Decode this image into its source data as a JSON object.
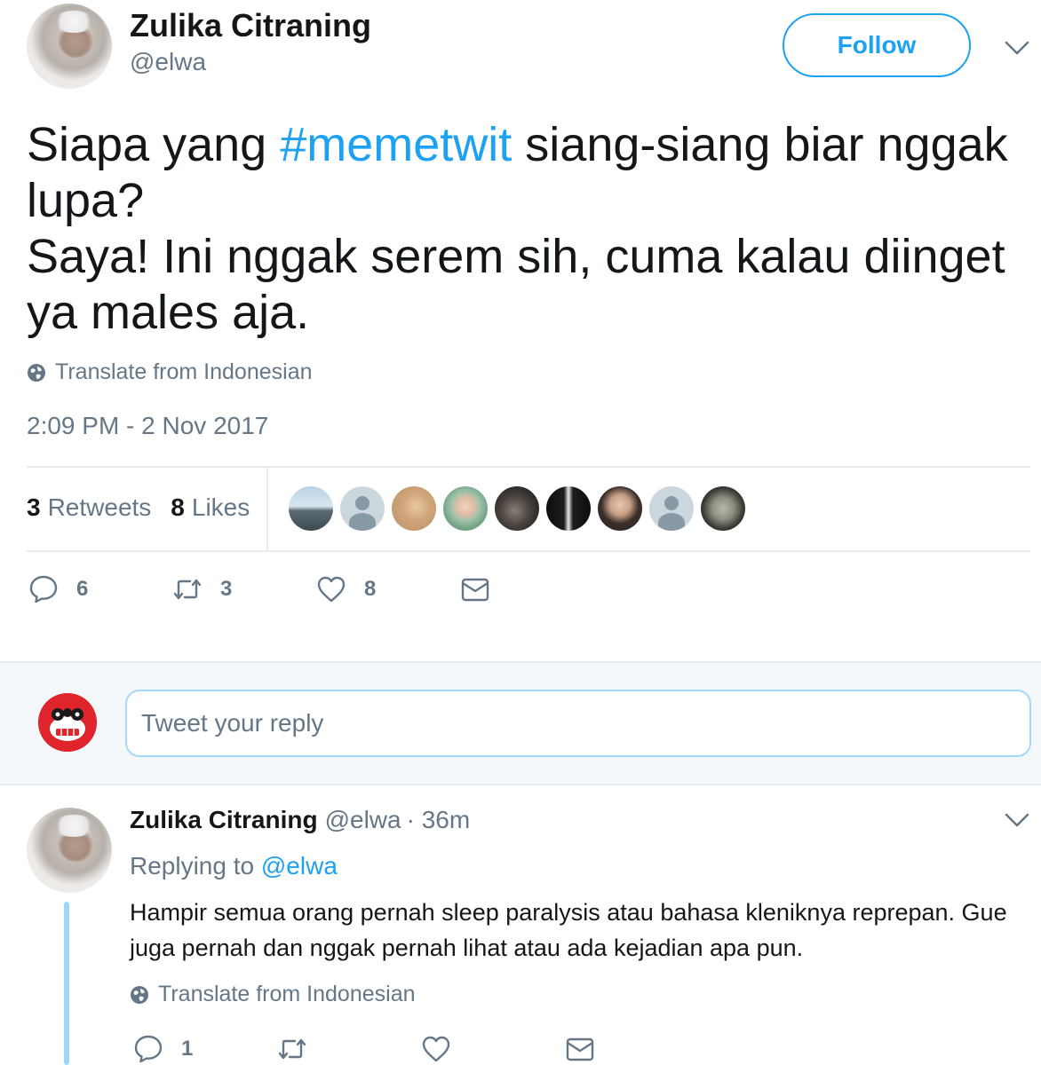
{
  "tweet": {
    "author_name": "Zulika Citraning",
    "author_handle": "@elwa",
    "follow_label": "Follow",
    "text_before_hashtag": "Siapa yang ",
    "hashtag": "#memetwit",
    "text_after_hashtag": " siang-siang biar nggak lupa?",
    "text_line2": "Saya! Ini nggak serem sih, cuma kalau diinget ya males aja.",
    "translate_label": "Translate from Indonesian",
    "timestamp": "2:09 PM - 2 Nov 2017",
    "retweet_count": "3",
    "retweets_label": "Retweets",
    "like_count": "8",
    "likes_label": "Likes",
    "likers": [
      {
        "icon": "landscape-photo"
      },
      {
        "icon": "default-profile"
      },
      {
        "icon": "sand-photo"
      },
      {
        "icon": "hijab-portrait"
      },
      {
        "icon": "cat-photo"
      },
      {
        "icon": "silhouette-photo"
      },
      {
        "icon": "portrait-photo"
      },
      {
        "icon": "default-profile"
      },
      {
        "icon": "car-window-photo"
      }
    ],
    "actions": {
      "reply_count": "6",
      "retweet_count": "3",
      "like_count": "8"
    }
  },
  "composer": {
    "placeholder": "Tweet your reply"
  },
  "reply": {
    "author_name": "Zulika Citraning",
    "author_handle": "@elwa",
    "time_ago": "· 36m",
    "replying_to_label": "Replying to",
    "replying_to_handle": "@elwa",
    "text": "Hampir semua orang pernah sleep paralysis atau bahasa kleniknya reprepan. Gue juga pernah dan nggak pernah lihat atau ada kejadian apa pun.",
    "translate_label": "Translate from Indonesian",
    "actions": {
      "reply_count": "1",
      "retweet_count": "",
      "like_count": ""
    }
  },
  "colors": {
    "accent": "#1da1f2",
    "secondary_text": "#657786",
    "primary_text": "#14171a"
  }
}
